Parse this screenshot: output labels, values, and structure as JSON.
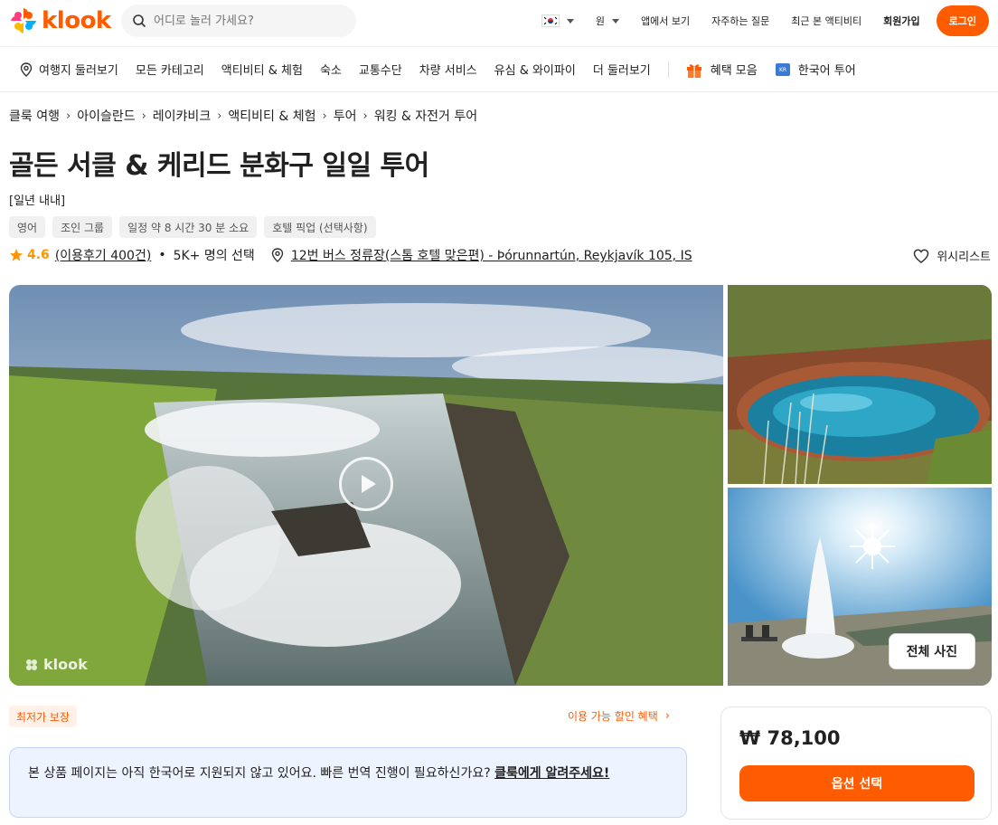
{
  "header": {
    "brand": "klook",
    "search_placeholder": "어디로 놀러 가세요?",
    "currency": "원",
    "app_link": "앱에서 보기",
    "faq": "자주하는 질문",
    "recent": "최근 본 액티비티",
    "signup": "회원가입",
    "login": "로그인"
  },
  "nav": {
    "items": [
      "여행지 둘러보기",
      "모든 카테고리",
      "액티비티 & 체험",
      "숙소",
      "교통수단",
      "차량 서비스",
      "유심 & 와이파이",
      "더 둘러보기"
    ],
    "benefits": "혜택 모음",
    "korean_tour": "한국어 투어"
  },
  "breadcrumb": [
    "클룩 여행",
    "아이슬란드",
    "레이캬비크",
    "액티비티 & 체험",
    "투어",
    "워킹 & 자전거 투어"
  ],
  "product": {
    "title": "골든 서클 & 케리드 분화구 일일 투어",
    "subtitle": "[일년 내내]",
    "tags": [
      "영어",
      "조인 그룹",
      "일정 약 8 시간 30 분 소요",
      "호텔 픽업 (선택사항)"
    ],
    "rating": "4.6",
    "reviews": "(이용후기 400건)",
    "booked": "5K+ 명의 선택",
    "location": "12번 버스 정류장(스톰 호텔 맞은편) - Þórunnartún, Reykjavík 105, IS",
    "wishlist": "위시리스트"
  },
  "gallery": {
    "all_photos": "전체 사진",
    "watermark": "klook"
  },
  "bottom": {
    "best_price": "최저가 보장",
    "discount_link": "이용 가능 할인 혜택",
    "notice_text": "본 상품 페이지는 아직 한국어로 지원되지 않고 있어요. 빠른 번역 진행이 필요하신가요?",
    "notice_link": "클룩에게 알려주세요!",
    "price": "₩ 78,100",
    "select_button": "옵션 선택"
  },
  "colors": {
    "brand": "#ff5b00",
    "rating": "#ff9500",
    "notice_bg": "#eef4ff"
  }
}
